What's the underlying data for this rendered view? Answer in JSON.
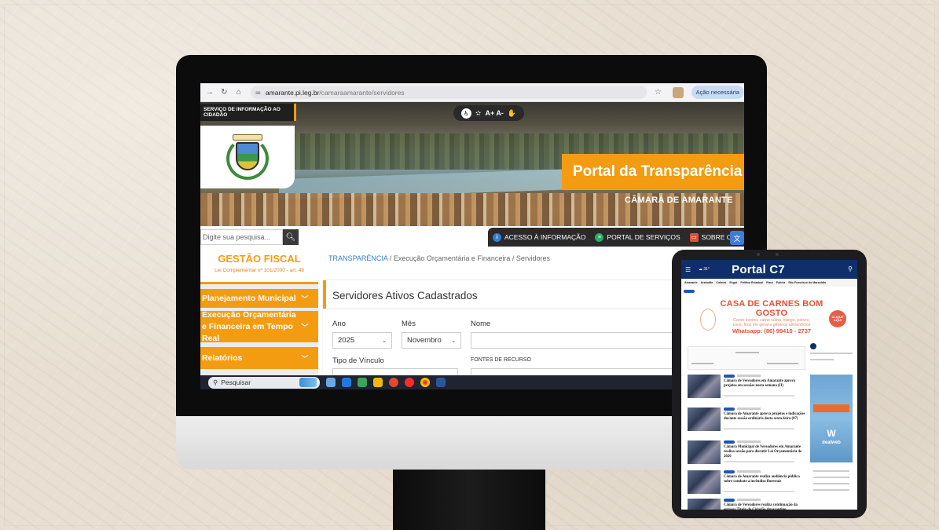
{
  "browser": {
    "url_host": "amarante.pi.leg.br",
    "url_path": "/camaraamarante/servidores",
    "action_label": "Ação necessária"
  },
  "site": {
    "sic_label": "SERVIÇO DE INFORMAÇÃO AO CIDADÃO",
    "font_controls": "A+  A-",
    "portal_title": "Portal da Transparência",
    "camara_label": "CÂMARA DE AMARANTE",
    "search_placeholder": "Digite sua pesquisa...",
    "quick_links": [
      {
        "label": "ACESSO À INFORMAÇÃO",
        "icon": "info-icon",
        "color": "#2f7fd0"
      },
      {
        "label": "PORTAL DE SERVIÇOS",
        "icon": "services-icon",
        "color": "#27ae60"
      },
      {
        "label": "SOBRE O MUNICÍ",
        "icon": "city-icon",
        "color": "#e74c3c"
      }
    ],
    "accent_color": "#f39c12"
  },
  "sidebar": {
    "gestao_title": "GESTÃO FISCAL",
    "gestao_subtitle": "Lei Complementar nº 101/2000 - art. 48",
    "items": [
      {
        "label": "Planejamento Municipal"
      },
      {
        "label": "Execução Orçamentária e Financeira em Tempo Real"
      },
      {
        "label": "Relatórios"
      }
    ]
  },
  "breadcrumb": {
    "root": "TRANSPARÊNCIA",
    "rest": " / Execução Orçamentária e Financeira / Servidores"
  },
  "main": {
    "title": "Servidores Ativos Cadastrados",
    "labels": {
      "ano": "Ano",
      "mes": "Mês",
      "nome": "Nome",
      "tipo_vinculo": "Tipo de Vínculo",
      "fontes": "FONTES DE RECURSO"
    },
    "ano_value": "2025",
    "mes_value": "Novembro"
  },
  "taskbar": {
    "search_label": "Pesquisar",
    "apps": [
      "#1f7ae0",
      "#3aa55c",
      "#f2b90d",
      "#e8472e",
      "#ff5722",
      "#e94235",
      "#2b579a"
    ]
  },
  "tablet": {
    "brand": "Portal C7",
    "nav": [
      "Amarante",
      "Arabutão",
      "Colinas",
      "Esgot",
      "Política Estadual",
      "Piauí",
      "Polícia",
      "São Francisco do Maranhão"
    ],
    "ad": {
      "headline": "CASA DE CARNES BOM GOSTO",
      "line1": "Carne bovina, carne suína, frango, peixes,",
      "line2": "ovos, frios em geral e gêneros alimentícios",
      "whatsapp": "Whatsapp: (86) 99410 - 2737",
      "click": "CLIQUE AQUI"
    },
    "news": [
      "Câmara de Vereadores em Amarante aprova projetos em sessões nesta semana (II)",
      "Câmara de Amarante aprova projetos e indicações durante sessão ordinária desta sexta-feira (07)",
      "Câmara Municipal de Vereadores em Amarante realiza sessão para discutir Lei Orçamentária de 2026",
      "Câmara de Amarante realiza audiência pública sobre combate a incêndios florestais",
      "Câmara de Vereadores realiza continuação da entrega Título de Cidadão Amarantino"
    ],
    "side_ad_brand": "dealweb"
  }
}
